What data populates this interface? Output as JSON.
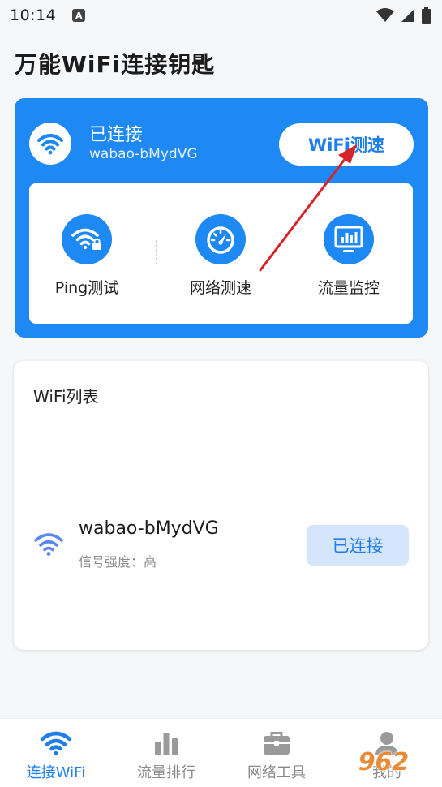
{
  "status_bar": {
    "time": "10:14",
    "app_badge": "A"
  },
  "app_title": "万能WiFi连接钥匙",
  "hero": {
    "status": "已连接",
    "ssid": "wabao-bMydVG",
    "speedtest_button": "WiFi测速",
    "tools": [
      {
        "label": "Ping测试",
        "icon": "wifi-lock-icon"
      },
      {
        "label": "网络测速",
        "icon": "speedometer-icon"
      },
      {
        "label": "流量监控",
        "icon": "monitor-chart-icon"
      }
    ]
  },
  "wifi_list": {
    "title": "WiFi列表",
    "networks": [
      {
        "ssid": "wabao-bMydVG",
        "signal": "信号强度：高",
        "action": "已连接"
      }
    ]
  },
  "bottom_nav": [
    {
      "label": "连接WiFi",
      "icon": "wifi-icon",
      "active": true
    },
    {
      "label": "流量排行",
      "icon": "bar-chart-icon",
      "active": false
    },
    {
      "label": "网络工具",
      "icon": "toolbox-icon",
      "active": false
    },
    {
      "label": "我的",
      "icon": "user-icon",
      "active": false
    }
  ],
  "watermark": "962",
  "colors": {
    "primary": "#1e88f5",
    "accent_text": "#1e7fe8",
    "connected_bg": "#d5e5fb",
    "arrow": "#d9232a"
  }
}
